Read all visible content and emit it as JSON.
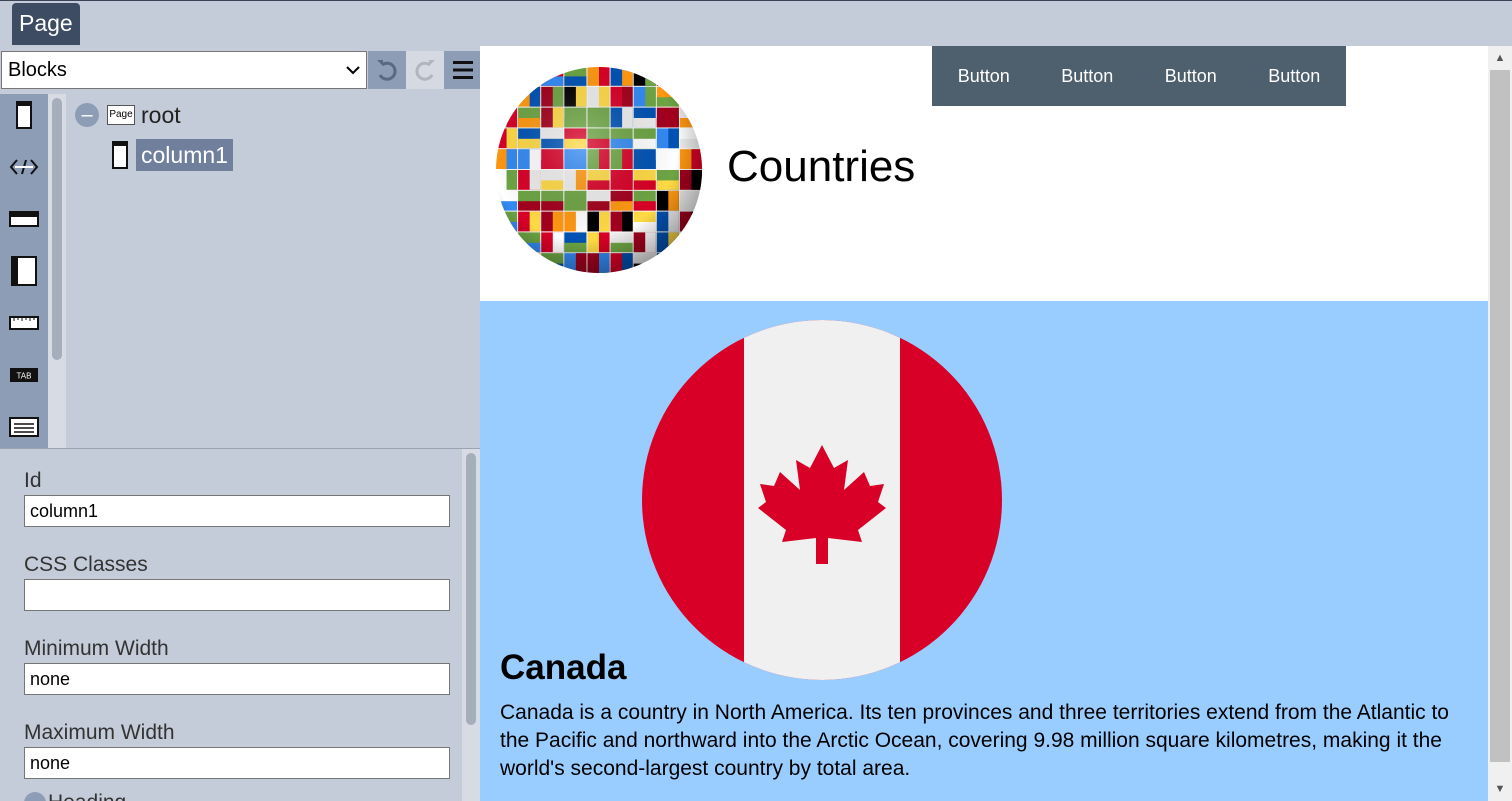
{
  "app": {
    "page_tab": "Page"
  },
  "toolbar": {
    "select_value": "Blocks",
    "undo_icon": "undo-icon",
    "redo_icon": "redo-icon",
    "menu_icon": "hamburger-menu-icon"
  },
  "palette": {
    "items": [
      "column-block-icon",
      "html-block-icon",
      "row-block-icon",
      "sidebar-block-icon",
      "ruler-block-icon",
      "tab-block-icon",
      "list-block-icon"
    ],
    "tab_glyph": "TAB"
  },
  "tree": {
    "root_icon_text": "Page",
    "root_label": "root",
    "child_label": "column1"
  },
  "properties": {
    "id_label": "Id",
    "id_value": "column1",
    "css_label": "CSS Classes",
    "css_value": "",
    "min_width_label": "Minimum Width",
    "min_width_value": "none",
    "max_width_label": "Maximum Width",
    "max_width_value": "none",
    "next_section_label": "Heading"
  },
  "preview": {
    "nav_buttons": [
      "Button",
      "Button",
      "Button",
      "Button"
    ],
    "title": "Countries",
    "country_name": "Canada",
    "country_description": "Canada is a country in North America. Its ten provinces and three territories extend from the Atlantic to the Pacific and northward into the Arctic Ocean, covering 9.98 million square kilometres, making it the world's second-largest country by total area.",
    "colors": {
      "nav_bg": "#4e5f6e",
      "content_bg": "#99ccff",
      "flag_red": "#d80027",
      "flag_white": "#f0f0f0"
    }
  }
}
